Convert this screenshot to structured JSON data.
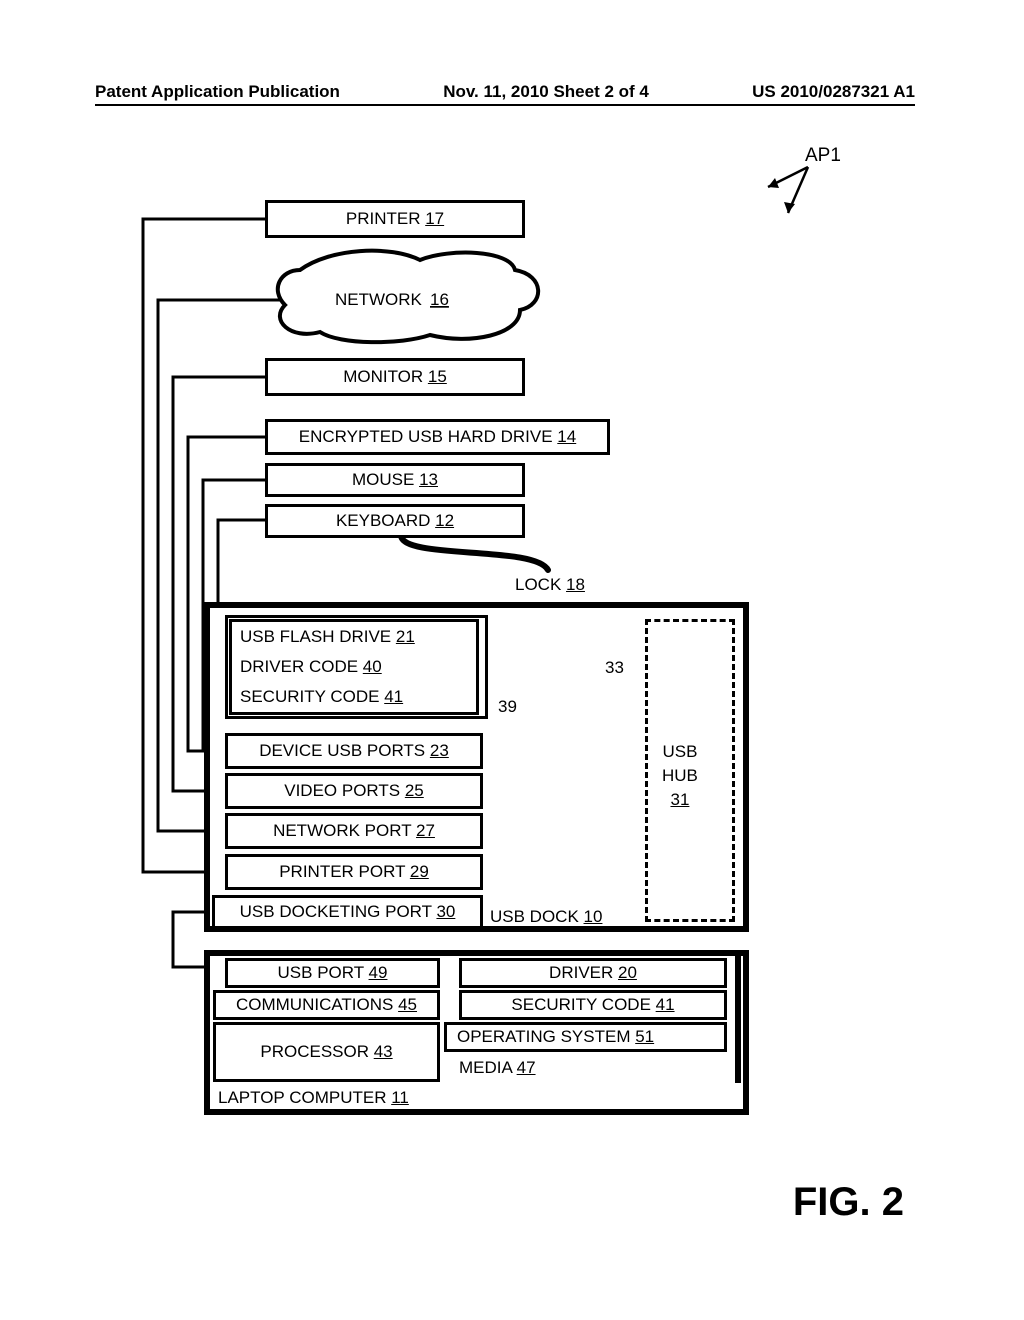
{
  "header": {
    "left": "Patent Application Publication",
    "center": "Nov. 11, 2010  Sheet 2 of 4",
    "right": "US 2010/0287321 A1"
  },
  "ap1_label": "AP1",
  "printer": {
    "name": "PRINTER ",
    "num": "17"
  },
  "network": {
    "name": "NETWORK ",
    "num": "16"
  },
  "monitor": {
    "name": "MONITOR ",
    "num": "15"
  },
  "encrypted": {
    "name": "ENCRYPTED USB HARD DRIVE ",
    "num": "14"
  },
  "mouse": {
    "name": "MOUSE ",
    "num": "13"
  },
  "keyboard": {
    "name": "KEYBOARD ",
    "num": "12"
  },
  "lock": {
    "name": "LOCK ",
    "num": "18"
  },
  "flash": {
    "title": {
      "name": "USB FLASH DRIVE ",
      "num": "21"
    },
    "driver": {
      "name": "DRIVER CODE ",
      "num": "40"
    },
    "security": {
      "name": "SECURITY CODE ",
      "num": "41"
    }
  },
  "ref33": "33",
  "ref39": "39",
  "usb_hub": {
    "line1": "USB",
    "line2": "HUB",
    "num": "31"
  },
  "device_ports": {
    "name": "DEVICE USB PORTS ",
    "num": "23"
  },
  "video_ports": {
    "name": "VIDEO PORTS ",
    "num": "25"
  },
  "network_port": {
    "name": "NETWORK PORT ",
    "num": "27"
  },
  "printer_port": {
    "name": "PRINTER PORT ",
    "num": "29"
  },
  "docking_port": {
    "name": "USB DOCKETING PORT ",
    "num": "30"
  },
  "usb_dock": {
    "name": "USB DOCK ",
    "num": "10"
  },
  "laptop": {
    "usb_port": {
      "name": "USB PORT ",
      "num": "49"
    },
    "driver": {
      "name": "DRIVER ",
      "num": "20"
    },
    "comms": {
      "name": "COMMUNICATIONS ",
      "num": "45"
    },
    "sec": {
      "name": "SECURITY CODE ",
      "num": "41"
    },
    "proc": {
      "name": "PROCESSOR ",
      "num": "43"
    },
    "os": {
      "name": "OPERATING SYSTEM ",
      "num": "51"
    },
    "media": {
      "name": "MEDIA ",
      "num": "47"
    },
    "title": {
      "name": "LAPTOP COMPUTER ",
      "num": "11"
    }
  },
  "figure": "FIG. 2"
}
